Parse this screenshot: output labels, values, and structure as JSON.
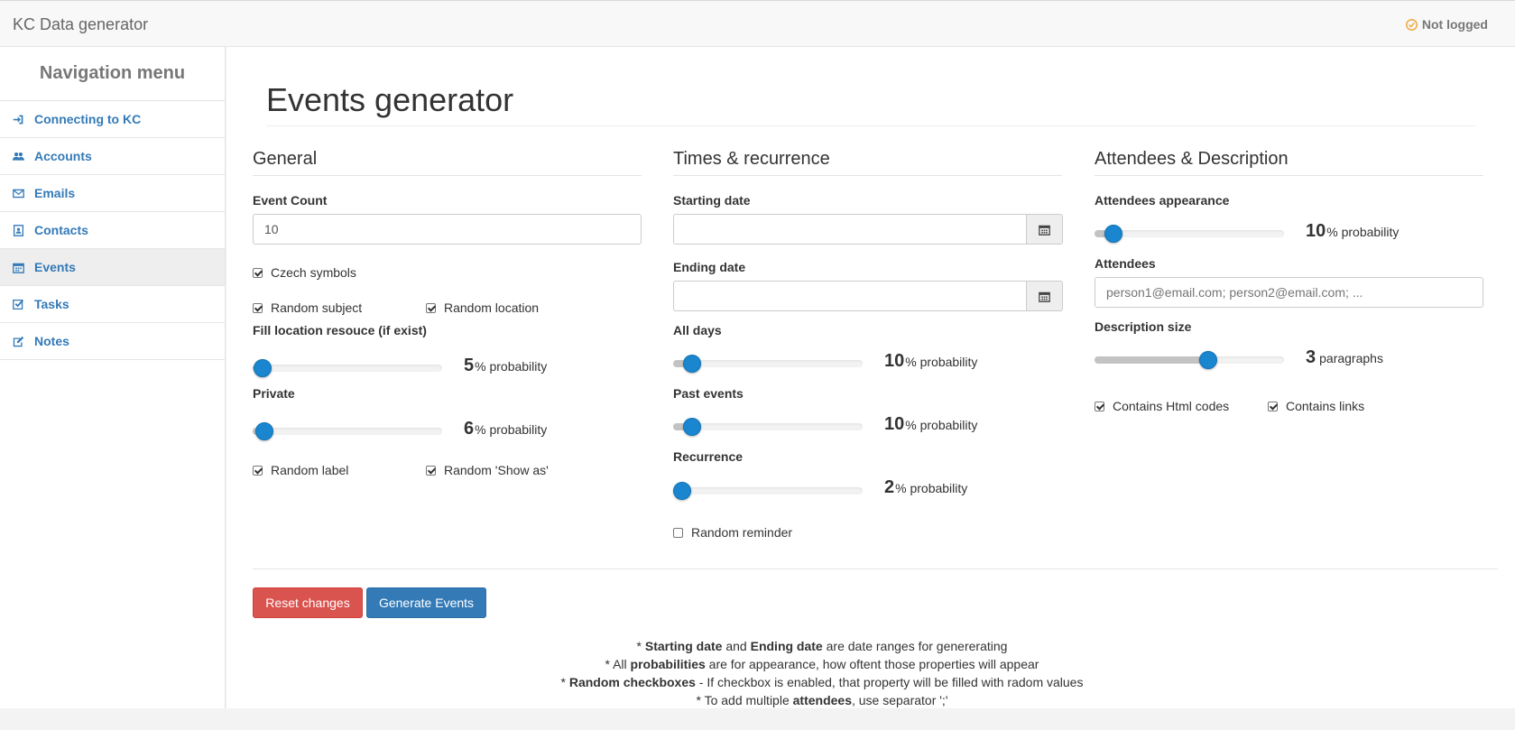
{
  "app": {
    "brand": "KC Data generator",
    "login_status": "Not logged"
  },
  "sidebar": {
    "title": "Navigation menu",
    "items": [
      {
        "label": "Connecting to KC",
        "icon": "sign-in-icon"
      },
      {
        "label": "Accounts",
        "icon": "users-icon"
      },
      {
        "label": "Emails",
        "icon": "envelope-icon"
      },
      {
        "label": "Contacts",
        "icon": "contact-card-icon"
      },
      {
        "label": "Events",
        "icon": "calendar-icon",
        "active": true
      },
      {
        "label": "Tasks",
        "icon": "check-square-icon"
      },
      {
        "label": "Notes",
        "icon": "edit-icon"
      }
    ]
  },
  "page": {
    "title": "Events generator"
  },
  "general": {
    "heading": "General",
    "event_count_label": "Event Count",
    "event_count_value": "10",
    "czech_symbols": {
      "label": "Czech symbols",
      "checked": true
    },
    "random_subject": {
      "label": "Random subject",
      "checked": true
    },
    "random_location": {
      "label": "Random location",
      "checked": true
    },
    "fill_location": {
      "label": "Fill location resouce (if exist)",
      "value": "5",
      "unit": "% probability",
      "fraction": 0.05
    },
    "private": {
      "label": "Private",
      "value": "6",
      "unit": "% probability",
      "fraction": 0.06
    },
    "random_label": {
      "label": "Random label",
      "checked": true
    },
    "random_show_as": {
      "label": "Random 'Show as'",
      "checked": true
    }
  },
  "times": {
    "heading": "Times & recurrence",
    "starting_date_label": "Starting date",
    "starting_date_value": "",
    "ending_date_label": "Ending date",
    "ending_date_value": "",
    "all_days": {
      "label": "All days",
      "value": "10",
      "unit": "% probability",
      "fraction": 0.1
    },
    "past_events": {
      "label": "Past events",
      "value": "10",
      "unit": "% probability",
      "fraction": 0.1
    },
    "recurrence": {
      "label": "Recurrence",
      "value": "2",
      "unit": "% probability",
      "fraction": 0.02
    },
    "random_reminder": {
      "label": "Random reminder",
      "checked": false
    }
  },
  "attendees": {
    "heading": "Attendees & Description",
    "appearance": {
      "label": "Attendees appearance",
      "value": "10",
      "unit": "% probability",
      "fraction": 0.1
    },
    "attendees_label": "Attendees",
    "attendees_placeholder": "person1@email.com; person2@email.com; ...",
    "description_size": {
      "label": "Description size",
      "value": "3",
      "unit": "paragraphs",
      "fraction": 0.6
    },
    "contains_html": {
      "label": "Contains Html codes",
      "checked": true
    },
    "contains_links": {
      "label": "Contains links",
      "checked": true
    }
  },
  "actions": {
    "reset_label": "Reset changes",
    "generate_label": "Generate Events"
  },
  "notes": [
    {
      "pre": "* ",
      "b1": "Starting date",
      "mid": " and ",
      "b2": "Ending date",
      "post": " are date ranges for genererating"
    },
    {
      "pre": "* All ",
      "b1": "probabilities",
      "post": " are for appearance, how oftent those properties will appear"
    },
    {
      "pre": "* ",
      "b1": "Random checkboxes",
      "post": " - If checkbox is enabled, that property will be filled with radom values"
    },
    {
      "pre": "* To add multiple ",
      "b1": "attendees",
      "post": ", use separator ';'"
    }
  ],
  "colors": {
    "accent": "#337ab7",
    "danger": "#d9534f",
    "slider_handle": "#1a86d0",
    "status_icon": "#f0ad4e"
  }
}
